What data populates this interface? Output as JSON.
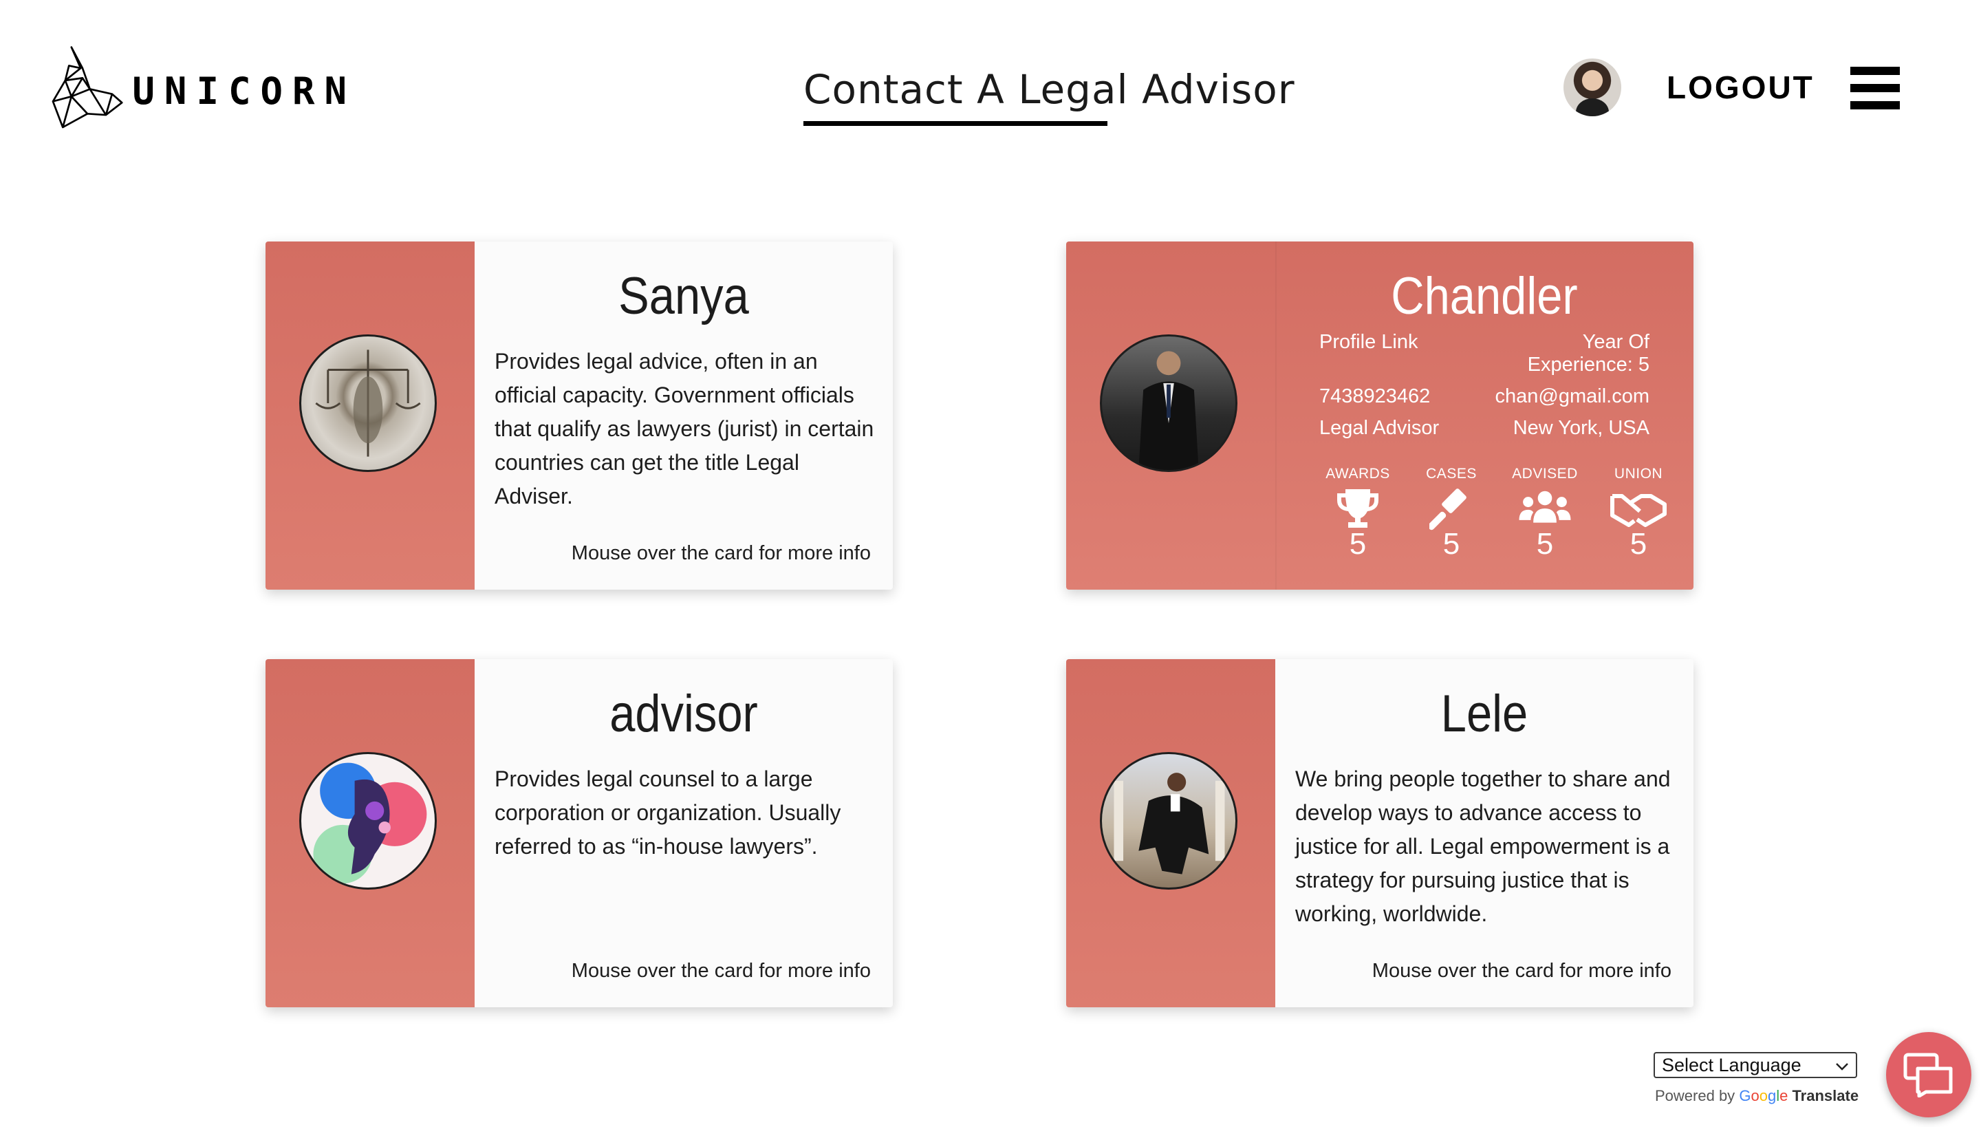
{
  "brand": {
    "name": "UNICORN",
    "logo_icon": "unicorn-head-icon"
  },
  "header": {
    "title": "Contact A Legal Advisor",
    "logout_label": "LOGOUT",
    "menu_icon": "hamburger-menu-icon"
  },
  "cards": [
    {
      "name": "Sanya",
      "description": "Provides legal advice, often in an official capacity. Government officials that qualify as lawyers (jurist) in certain countries can get the title Legal Adviser.",
      "hint": "Mouse over the card for more info"
    },
    {
      "name": "Chandler",
      "profile_link": "Profile Link",
      "experience": "Year Of Experience: 5",
      "phone": "7438923462",
      "email": "chan@gmail.com",
      "role": "Legal Advisor",
      "location": "New York, USA",
      "stats": [
        {
          "label": "AWARDS",
          "value": "5",
          "icon": "trophy-icon"
        },
        {
          "label": "CASES",
          "value": "5",
          "icon": "gavel-icon"
        },
        {
          "label": "ADVISED",
          "value": "5",
          "icon": "users-icon"
        },
        {
          "label": "UNION",
          "value": "5",
          "icon": "handshake-icon"
        }
      ]
    },
    {
      "name": "advisor",
      "description": "Provides legal counsel to a large corporation or organization. Usually referred to as “in-house lawyers”.",
      "hint": "Mouse over the card for more info"
    },
    {
      "name": "Lele",
      "description": "We bring people together to share and develop ways to advance access to justice for all. Legal empowerment is a strategy for pursuing justice that is working, worldwide.",
      "hint": "Mouse over the card for more info"
    }
  ],
  "translate": {
    "select_label": "Select Language",
    "powered_by": "Powered by",
    "google": [
      "G",
      "o",
      "o",
      "g",
      "l",
      "e"
    ],
    "translate_word": "Translate"
  },
  "colors": {
    "card_accent": "#d36d62",
    "chat_button": "#e15f66"
  }
}
